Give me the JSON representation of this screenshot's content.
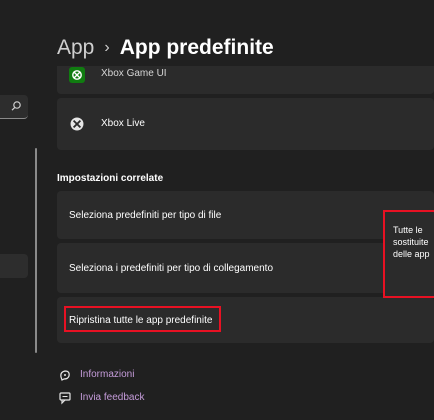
{
  "header": {
    "parent": "App",
    "separator": "›",
    "current": "App predefinite"
  },
  "apps": [
    {
      "label": "Xbox Game UI",
      "icon": "xbox-game-ui-icon",
      "color": "#107c10"
    },
    {
      "label": "Xbox Live",
      "icon": "xbox-icon"
    }
  ],
  "related": {
    "title": "Impostazioni correlate",
    "items": [
      {
        "label": "Seleziona predefiniti per tipo di file"
      },
      {
        "label": "Seleziona i predefiniti per tipo di collegamento"
      },
      {
        "label": "Ripristina tutte le app predefinite"
      }
    ]
  },
  "tooltip": {
    "lines": [
      "Tutte le",
      "sostituite",
      "delle app"
    ]
  },
  "footer": {
    "links": [
      {
        "label": "Informazioni",
        "icon": "help-icon"
      },
      {
        "label": "Invia feedback",
        "icon": "feedback-icon"
      }
    ]
  },
  "colors": {
    "background": "#202020",
    "card": "#2b2b2b",
    "highlight": "#e81123",
    "link": "#c49bd9",
    "xbox_green": "#107c10"
  }
}
